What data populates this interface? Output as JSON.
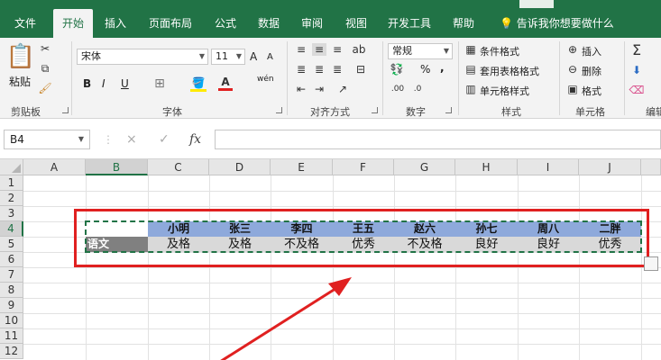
{
  "tabs": [
    "文件",
    "开始",
    "插入",
    "页面布局",
    "公式",
    "数据",
    "审阅",
    "视图",
    "开发工具",
    "帮助"
  ],
  "tell_me": "告诉我你想要做什么",
  "ribbon": {
    "clipboard": {
      "paste": "粘贴",
      "label": "剪贴板"
    },
    "font": {
      "name": "宋体",
      "size": "11",
      "label": "字体",
      "bold": "B",
      "italic": "I",
      "underline": "U",
      "grow": "A",
      "shrink": "A",
      "phonetic": "wén"
    },
    "alignment": {
      "label": "对齐方式"
    },
    "number": {
      "format": "常规",
      "label": "数字",
      "percent": "%",
      "comma": ","
    },
    "styles": {
      "conditional": "条件格式",
      "table": "套用表格格式",
      "cell": "单元格样式",
      "label": "样式"
    },
    "cells": {
      "insert": "插入",
      "delete": "删除",
      "format": "格式",
      "label": "单元格"
    },
    "editing": {
      "label": "编辑"
    }
  },
  "formula_bar": {
    "name_box": "B4",
    "cancel": "×",
    "enter": "✓",
    "fx": "fx",
    "value": ""
  },
  "grid": {
    "columns": [
      "A",
      "B",
      "C",
      "D",
      "E",
      "F",
      "G",
      "H",
      "I",
      "J"
    ],
    "rows": [
      "1",
      "2",
      "3",
      "4",
      "5",
      "6",
      "7",
      "8",
      "9",
      "10",
      "11",
      "12"
    ],
    "selected_column": "B",
    "selected_row": "4"
  },
  "table": {
    "names": [
      "小明",
      "张三",
      "李四",
      "王五",
      "赵六",
      "孙七",
      "周八",
      "二胖"
    ],
    "subject": "语文",
    "grades": [
      "及格",
      "及格",
      "不及格",
      "优秀",
      "不及格",
      "良好",
      "良好",
      "优秀"
    ]
  },
  "colors": {
    "accent": "#217346",
    "header_fill": "#8ea9db",
    "value_fill": "#d9d9d9",
    "subject_fill": "#808080",
    "highlight": "#e02020"
  }
}
